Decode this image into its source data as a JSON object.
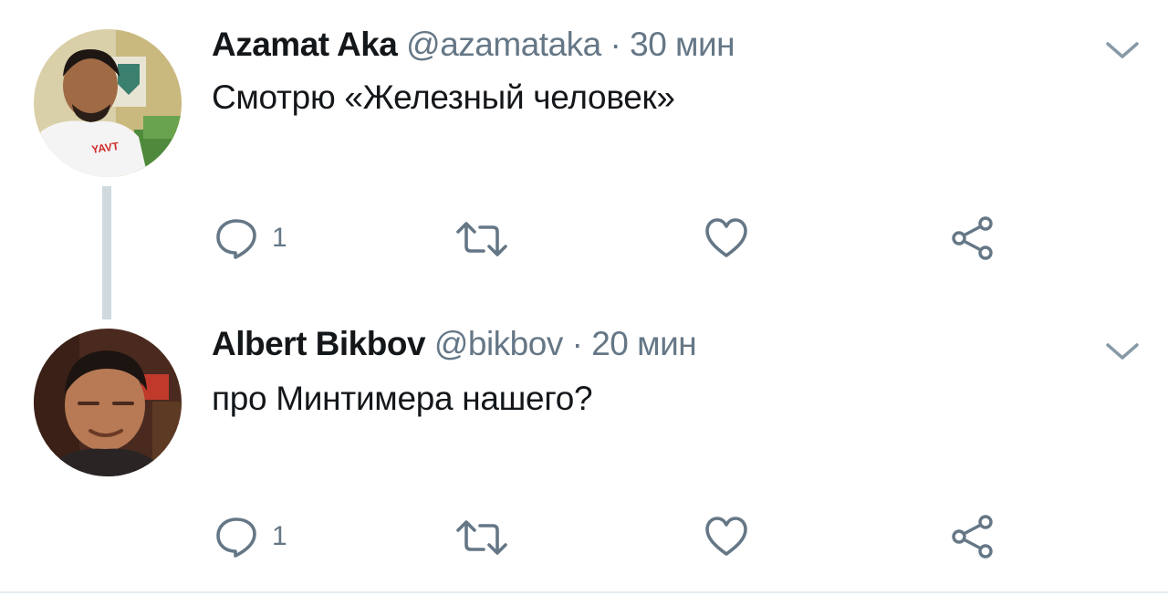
{
  "tweets": [
    {
      "name": "Azamat Aka",
      "handle": "@azamataka",
      "separator": "·",
      "time": "30 мин",
      "text": "Смотрю «Железный человек»",
      "reply_count": "1",
      "avatar_colors": {
        "bg": "#cbb886",
        "skin": "#a06a45",
        "shirt": "#f4f4f4",
        "hair": "#1d1612",
        "green": "#4f8a3c"
      }
    },
    {
      "name": "Albert Bikbov",
      "handle": "@bikbov",
      "separator": "·",
      "time": "20 мин",
      "text": "про Минтимера нашего?",
      "reply_count": "1",
      "avatar_colors": {
        "bg": "#4a2a1e",
        "skin": "#b77a55",
        "shirt": "#2b2424",
        "hair": "#1c1410",
        "accent": "#c0392b"
      }
    }
  ],
  "icons": {
    "reply": "reply-icon",
    "retweet": "retweet-icon",
    "like": "like-icon",
    "share": "share-icon",
    "menu": "chevron-down-icon"
  },
  "colors": {
    "icon": "#657786",
    "text": "#14171a",
    "muted": "#657786",
    "thread_line": "#cfd9de"
  }
}
